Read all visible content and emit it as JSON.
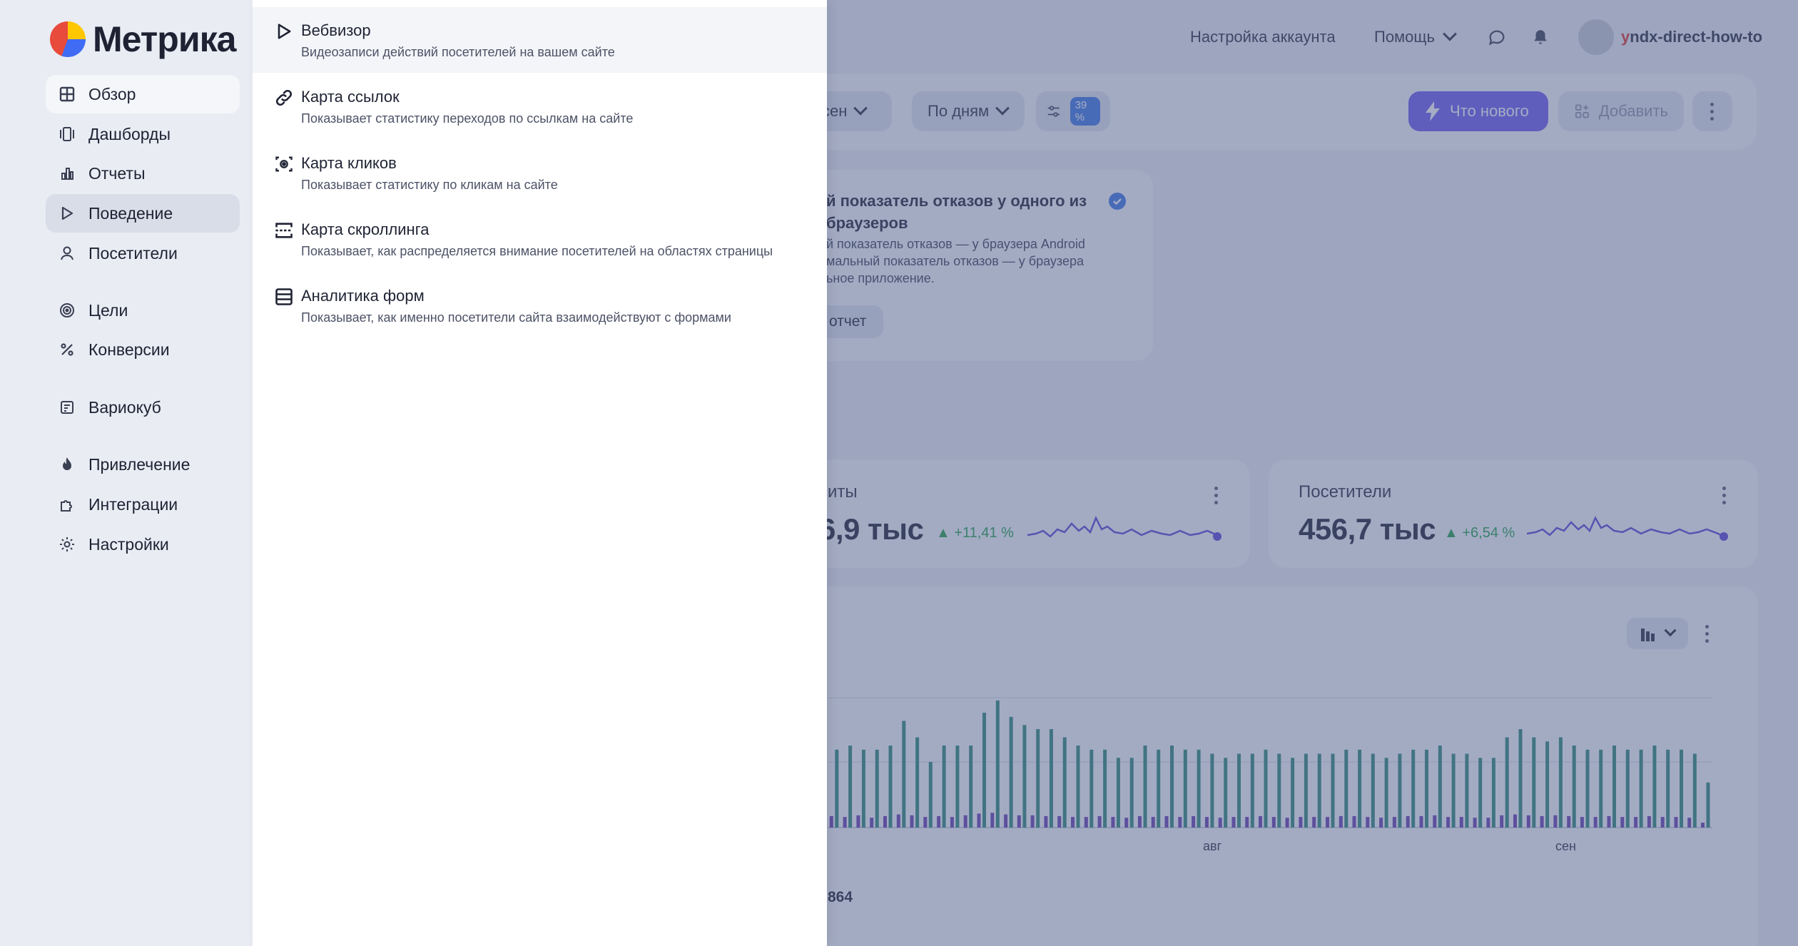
{
  "app": {
    "brand": "Метрика"
  },
  "nav": {
    "items": [
      {
        "label": "Обзор",
        "icon": "grid-icon"
      },
      {
        "label": "Дашборды",
        "icon": "dashboards-icon"
      },
      {
        "label": "Отчеты",
        "icon": "bar-chart-icon"
      },
      {
        "label": "Поведение",
        "icon": "play-icon"
      },
      {
        "label": "Посетители",
        "icon": "person-icon"
      },
      {
        "label": "Цели",
        "icon": "target-icon"
      },
      {
        "label": "Конверсии",
        "icon": "percent-icon"
      },
      {
        "label": "Вариокуб",
        "icon": "variocube-icon"
      },
      {
        "label": "Привлечение",
        "icon": "flame-icon"
      },
      {
        "label": "Интеграции",
        "icon": "puzzle-icon"
      },
      {
        "label": "Настройки",
        "icon": "gear-icon"
      }
    ]
  },
  "submenu": {
    "items": [
      {
        "title": "Вебвизор",
        "desc": "Видеозаписи действий посетителей на вашем сайте",
        "icon": "play-icon"
      },
      {
        "title": "Карта ссылок",
        "desc": "Показывает статистику переходов по ссылкам на сайте",
        "icon": "link-icon"
      },
      {
        "title": "Карта кликов",
        "desc": "Показывает статистику по кликам на сайте",
        "icon": "click-target-icon"
      },
      {
        "title": "Карта скроллинга",
        "desc": "Показывает, как распределяется внимание посетителей на областях страницы",
        "icon": "scroll-icon"
      },
      {
        "title": "Аналитика форм",
        "desc": "Показывает, как именно посетители сайта взаимодействуют с формами",
        "icon": "form-icon"
      }
    ]
  },
  "header": {
    "account_settings": "Настройка аккаунта",
    "help": "Помощь",
    "username_first": "y",
    "username_rest": "ndx-direct-how-to"
  },
  "toolbar": {
    "period_partial": "сен",
    "group_by": "По дням",
    "sampling_badge": "39 %",
    "whats_new": "Что нового",
    "add": "Добавить"
  },
  "notice": {
    "title_line1": "й показатель отказов у одного из",
    "title_line2": "браузеров",
    "text_line1": "й показатель отказов — у браузера Android",
    "text_line2": "мальный показатель отказов — у браузера",
    "text_line3": "ьное приложение.",
    "button": "отчет"
  },
  "metrics": {
    "visits": {
      "title": "иты",
      "value": "6,9 тыс",
      "delta": "▲ +11,41 %"
    },
    "visitors": {
      "title": "Посетители",
      "value": "456,7 тыс",
      "delta": "▲ +6,54 %"
    }
  },
  "chart_data": {
    "type": "bar",
    "x_tick_labels": [
      "авг",
      "сен"
    ],
    "series": [
      {
        "color": "#2f8a79",
        "values": [
          95,
          100,
          95,
          95,
          100,
          130,
          110,
          80,
          100,
          100,
          100,
          140,
          155,
          135,
          125,
          120,
          120,
          110,
          100,
          95,
          95,
          85,
          85,
          100,
          95,
          100,
          95,
          95,
          90,
          85,
          90,
          90,
          95,
          90,
          85,
          90,
          90,
          90,
          95,
          95,
          90,
          85,
          90,
          95,
          95,
          100,
          90,
          90,
          85,
          85,
          110,
          120,
          110,
          105,
          110,
          100,
          95,
          95,
          100,
          95,
          95,
          100,
          95,
          95,
          90,
          55
        ]
      },
      {
        "color": "#6a40b0",
        "values": [
          14,
          13,
          15,
          12,
          14,
          16,
          15,
          13,
          14,
          13,
          15,
          17,
          18,
          16,
          15,
          15,
          14,
          14,
          13,
          13,
          14,
          13,
          12,
          14,
          13,
          14,
          13,
          14,
          13,
          12,
          13,
          13,
          14,
          13,
          12,
          13,
          13,
          13,
          14,
          14,
          13,
          12,
          13,
          14,
          14,
          15,
          13,
          13,
          12,
          12,
          15,
          16,
          15,
          14,
          15,
          14,
          13,
          13,
          14,
          13,
          13,
          14,
          13,
          13,
          12,
          6
        ]
      }
    ]
  },
  "footer_number": "864",
  "colors": {
    "accent": "#6d5cf2",
    "positive": "#25a348",
    "sparkline": "#5b48d8"
  }
}
